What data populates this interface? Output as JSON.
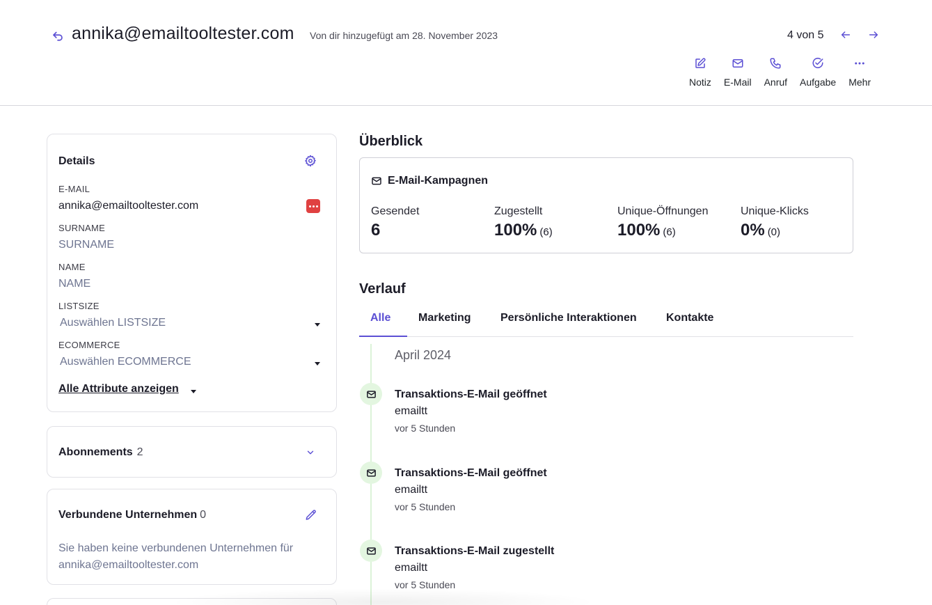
{
  "header": {
    "title": "annika@emailtooltester.com",
    "added_note": "Von dir hinzugefügt am 28. November 2023",
    "pager": "4 von 5",
    "actions": [
      {
        "label": "Notiz",
        "icon": "note-icon"
      },
      {
        "label": "E-Mail",
        "icon": "envelope-icon"
      },
      {
        "label": "Anruf",
        "icon": "phone-icon"
      },
      {
        "label": "Aufgabe",
        "icon": "check-circle-icon"
      },
      {
        "label": "Mehr",
        "icon": "more-icon"
      }
    ]
  },
  "details": {
    "title": "Details",
    "fields": {
      "email_label": "E-MAIL",
      "email_value": "annika@emailtooltester.com",
      "surname_label": "SURNAME",
      "surname_placeholder": "SURNAME",
      "name_label": "NAME",
      "name_placeholder": "NAME",
      "listsize_label": "LISTSIZE",
      "listsize_value": "Auswählen LISTSIZE",
      "ecommerce_label": "ECOMMERCE",
      "ecommerce_value": "Auswählen ECOMMERCE"
    },
    "all_attributes": "Alle Attribute anzeigen"
  },
  "subscriptions": {
    "title": "Abonnements",
    "count": "2"
  },
  "companies": {
    "title": "Verbundene Unternehmen",
    "count": "0",
    "empty_text": "Sie haben keine verbundenen Unternehmen für annika@emailtooltester.com"
  },
  "overview": {
    "title": "Überblick",
    "campaigns_title": "E-Mail-Kampagnen",
    "stats": [
      {
        "label": "Gesendet",
        "value": "6",
        "sub": ""
      },
      {
        "label": "Zugestellt",
        "value": "100%",
        "sub": "(6)"
      },
      {
        "label": "Unique-Öffnungen",
        "value": "100%",
        "sub": "(6)"
      },
      {
        "label": "Unique-Klicks",
        "value": "0%",
        "sub": "(0)"
      }
    ]
  },
  "history": {
    "title": "Verlauf",
    "tabs": [
      "Alle",
      "Marketing",
      "Persönliche Interaktionen",
      "Kontakte"
    ],
    "month": "April 2024",
    "events": [
      {
        "title": "Transaktions-E-Mail geöffnet",
        "sub": "emailtt",
        "time": "vor 5 Stunden"
      },
      {
        "title": "Transaktions-E-Mail geöffnet",
        "sub": "emailtt",
        "time": "vor 5 Stunden"
      },
      {
        "title": "Transaktions-E-Mail zugestellt",
        "sub": "emailtt",
        "time": "vor 5 Stunden"
      }
    ]
  },
  "colors": {
    "accent": "#5b4fd4",
    "badge": "#e04141",
    "timeline": "#e3f6e0"
  }
}
